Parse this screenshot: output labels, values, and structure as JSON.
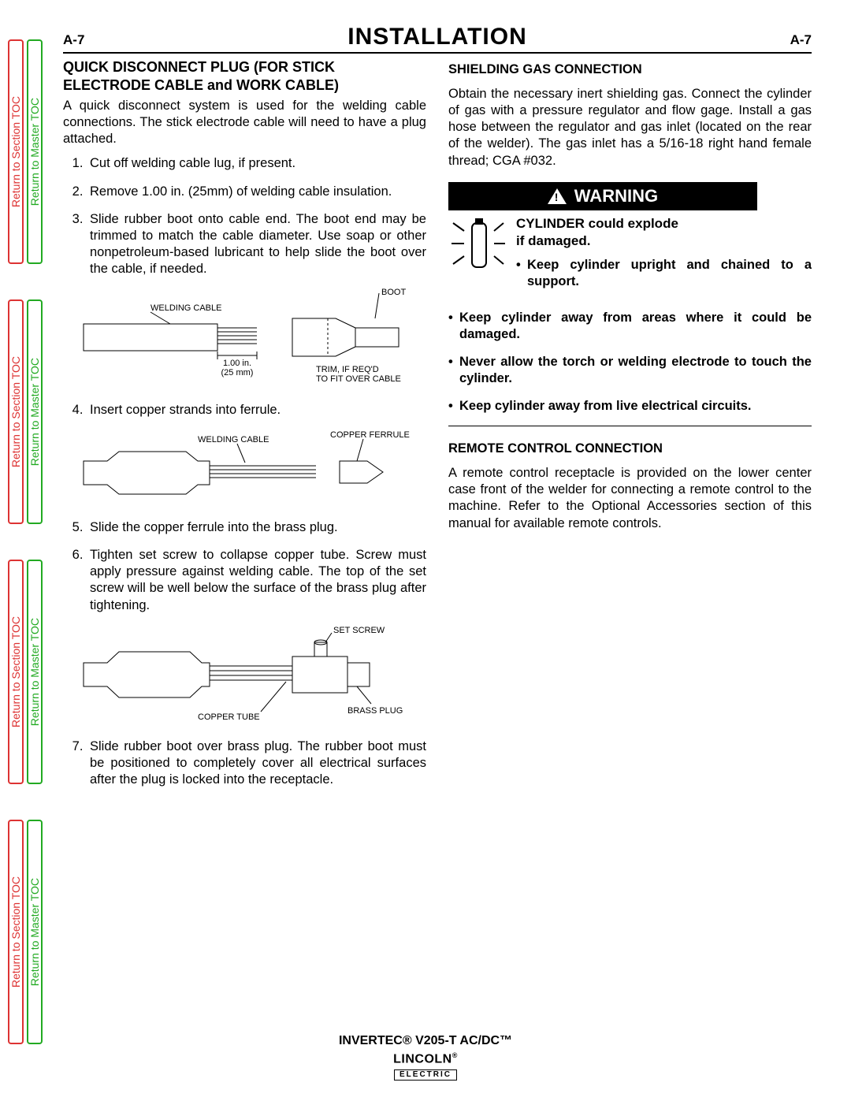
{
  "side_tabs": {
    "section_label": "Return to Section TOC",
    "master_label": "Return to Master TOC"
  },
  "header": {
    "left": "A-7",
    "title": "INSTALLATION",
    "right": "A-7"
  },
  "left_col": {
    "h2_line1": "QUICK DISCONNECT PLUG (FOR STICK",
    "h2_line2": "ELECTRODE CABLE and WORK CABLE)",
    "intro": "A quick disconnect system is used for the welding cable connections. The stick electrode cable will need to have a plug attached.",
    "steps": [
      "Cut off welding cable lug, if present.",
      "Remove 1.00 in. (25mm) of welding cable insulation.",
      "Slide rubber boot onto cable end. The boot end may be trimmed to match the cable diameter. Use soap or other nonpetroleum-based lubricant to help slide the boot over the cable, if needed.",
      "Insert copper strands into ferrule.",
      "Slide the copper ferrule into the brass plug.",
      "Tighten set screw to collapse copper tube. Screw must apply pressure against welding cable. The top of the set screw will be well below the surface of the brass plug after tightening.",
      "Slide rubber boot over brass plug. The rubber boot must be positioned to completely cover all electrical surfaces after the plug is locked into the receptacle."
    ],
    "fig1": {
      "welding_cable": "WELDING CABLE",
      "boot": "BOOT",
      "dim_in": "1.00 in.",
      "dim_mm": "(25 mm)",
      "trim1": "TRIM, IF REQ'D",
      "trim2": "TO FIT OVER CABLE"
    },
    "fig2": {
      "welding_cable": "WELDING CABLE",
      "copper_ferrule": "COPPER FERRULE"
    },
    "fig3": {
      "set_screw": "SET SCREW",
      "copper_tube": "COPPER TUBE",
      "brass_plug": "BRASS PLUG"
    }
  },
  "right_col": {
    "shield_h": "SHIELDING GAS CONNECTION",
    "shield_p": "Obtain the necessary inert shielding gas. Connect the cylinder of gas with a pressure regulator and flow gage. Install a gas hose between the regulator and gas inlet (located on the rear of the welder). The gas inlet has a 5/16-18 right hand female thread; CGA #032.",
    "warning_label": "WARNING",
    "warn_lead1": "CYLINDER could explode",
    "warn_lead2": "if damaged.",
    "warn_first_bullet": "Keep cylinder upright and chained to a support.",
    "warn_bullets": [
      "Keep cylinder away from areas where it could be damaged.",
      "Never allow the torch or welding electrode to touch the cylinder.",
      "Keep cylinder away from live electrical circuits."
    ],
    "remote_h": "REMOTE CONTROL CONNECTION",
    "remote_p": "A remote control receptacle is provided on the lower center case front of the welder for connecting a remote control to the machine. Refer to the Optional Accessories section of this manual for available remote controls."
  },
  "footer": {
    "model": "INVERTEC® V205-T AC/DC™",
    "logo_top": "LINCOLN",
    "logo_reg": "®",
    "logo_bot": "ELECTRIC"
  }
}
